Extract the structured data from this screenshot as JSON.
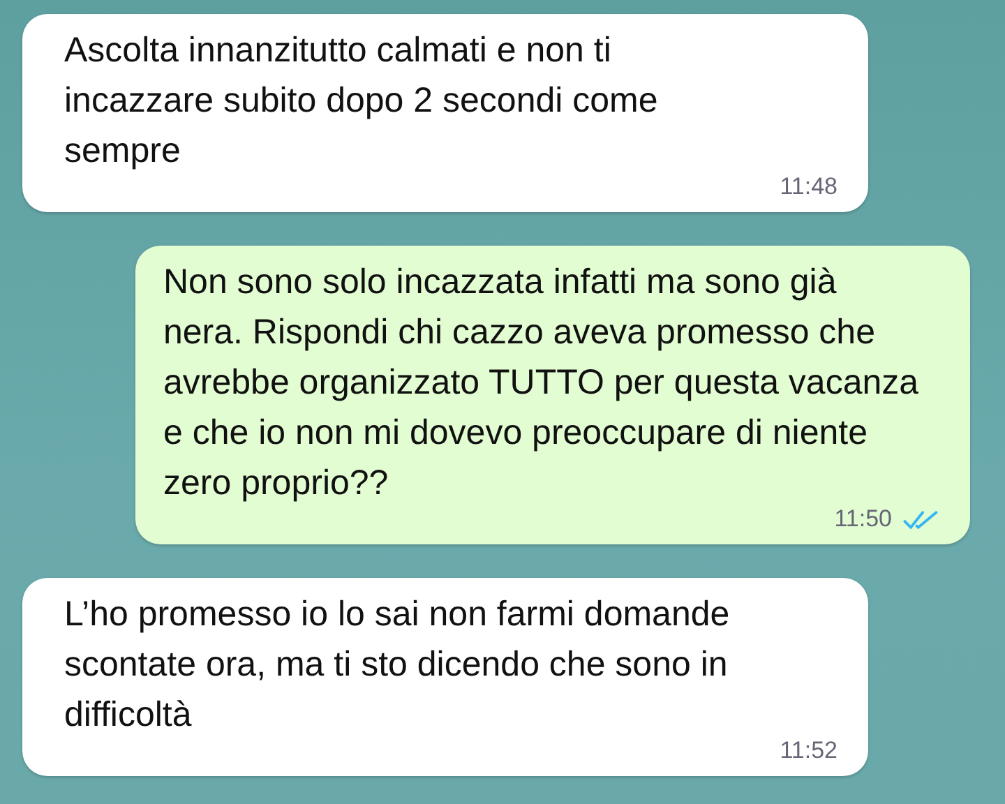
{
  "messages": [
    {
      "kind": "incoming",
      "text": "Ascolta innanzitutto calmati e non ti incazzare subito dopo 2 secondi come sempre",
      "time": "11:48"
    },
    {
      "kind": "outgoing",
      "text": "Non sono solo incazzata infatti ma sono già nera. Rispondi chi cazzo aveva promesso che avrebbe organizzato TUTTO per questa vacanza e che io non mi dovevo preoccupare di niente zero proprio??",
      "time": "11:50",
      "read": true
    },
    {
      "kind": "incoming",
      "text": "L’ho promesso io lo sai non farmi domande scontate ora, ma ti sto dicendo che sono in difficoltà",
      "time": "11:52"
    }
  ]
}
